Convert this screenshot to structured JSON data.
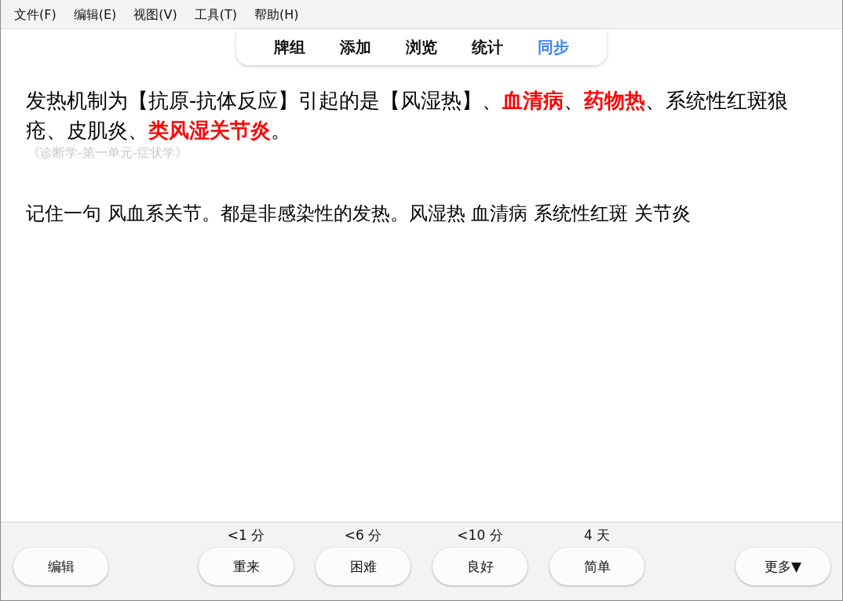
{
  "menu": [
    "文件(F)",
    "编辑(E)",
    "视图(V)",
    "工具(T)",
    "帮助(H)"
  ],
  "tabs": [
    {
      "label": "牌组",
      "selected": false
    },
    {
      "label": "添加",
      "selected": false
    },
    {
      "label": "浏览",
      "selected": false
    },
    {
      "label": "统计",
      "selected": false
    },
    {
      "label": "同步",
      "selected": true
    }
  ],
  "card": {
    "text": "发热机制为【抗原-抗体反应】引起的是【风湿热】、**血清病**、**药物热**、系统性红斑狼疮、皮肌炎、**类风湿关节炎**。",
    "source": "《诊断学-第一单元-症状学》",
    "note": "记住一句 风血系关节。都是非感染性的发热。风湿热 血清病 系统性红斑 关节炎"
  },
  "bottom_bar": {
    "edit_button": "编辑",
    "answers": [
      {
        "interval": "<1 分",
        "label": "重来"
      },
      {
        "interval": "<6 分",
        "label": "困难"
      },
      {
        "interval": "<10 分",
        "label": "良好"
      },
      {
        "interval": "4 天",
        "label": "简单"
      }
    ],
    "more_button": "更多▼"
  }
}
